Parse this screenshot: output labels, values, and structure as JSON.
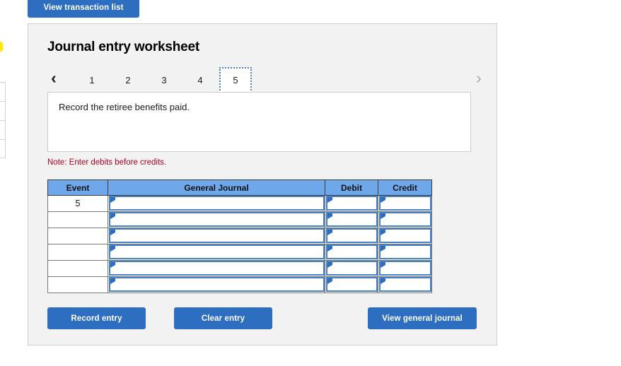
{
  "toolbar": {
    "view_transaction_list_label": "View transaction list"
  },
  "worksheet": {
    "title": "Journal entry worksheet",
    "pager": {
      "prev_icon": "chevron-left-icon",
      "prev_glyph": "‹",
      "next_icon": "chevron-right-icon",
      "next_glyph": "›",
      "pages": [
        "1",
        "2",
        "3",
        "4",
        "5"
      ],
      "active_page": "5"
    },
    "description": "Record the retiree benefits paid.",
    "note": "Note: Enter debits before credits."
  },
  "journal_table": {
    "headers": [
      "Event",
      "General Journal",
      "Debit",
      "Credit"
    ],
    "rows": [
      {
        "event": "5",
        "general_journal": "",
        "debit": "",
        "credit": ""
      },
      {
        "event": "",
        "general_journal": "",
        "debit": "",
        "credit": ""
      },
      {
        "event": "",
        "general_journal": "",
        "debit": "",
        "credit": ""
      },
      {
        "event": "",
        "general_journal": "",
        "debit": "",
        "credit": ""
      },
      {
        "event": "",
        "general_journal": "",
        "debit": "",
        "credit": ""
      },
      {
        "event": "",
        "general_journal": "",
        "debit": "",
        "credit": ""
      }
    ]
  },
  "actions": {
    "record_entry_label": "Record entry",
    "clear_entry_label": "Clear entry",
    "view_general_journal_label": "View general journal"
  },
  "colors": {
    "primary_button": "#2e6ec0",
    "table_header": "#6fa8ea",
    "panel_background": "#f2f2f2",
    "note_text": "#b00020",
    "input_border": "#4a80c4"
  }
}
